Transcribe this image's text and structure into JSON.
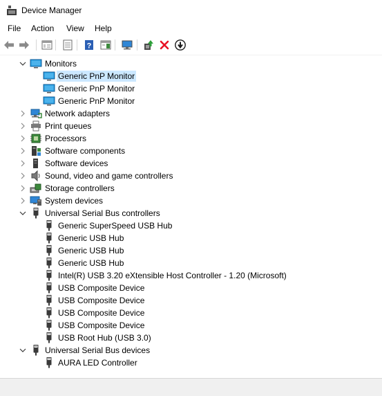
{
  "window": {
    "title": "Device Manager"
  },
  "menu": [
    "File",
    "Action",
    "View",
    "Help"
  ],
  "toolbar": [
    {
      "name": "back-icon"
    },
    {
      "name": "forward-icon"
    },
    {
      "name": "sep"
    },
    {
      "name": "show-hide-console-tree-icon"
    },
    {
      "name": "sep"
    },
    {
      "name": "properties-icon"
    },
    {
      "name": "sep"
    },
    {
      "name": "help-icon"
    },
    {
      "name": "action-pane-icon"
    },
    {
      "name": "sep"
    },
    {
      "name": "scan-hardware-icon"
    },
    {
      "name": "sep"
    },
    {
      "name": "update-driver-icon"
    },
    {
      "name": "uninstall-device-icon"
    },
    {
      "name": "disable-device-icon"
    }
  ],
  "tree": [
    {
      "level": 0,
      "expand": "expanded",
      "icon": "monitor-icon",
      "label": "Monitors"
    },
    {
      "level": 1,
      "icon": "monitor-icon",
      "label": "Generic PnP Monitor",
      "selected": true
    },
    {
      "level": 1,
      "icon": "monitor-icon",
      "label": "Generic PnP Monitor"
    },
    {
      "level": 1,
      "icon": "monitor-icon",
      "label": "Generic PnP Monitor"
    },
    {
      "level": 0,
      "expand": "collapsed",
      "icon": "network-adapter-icon",
      "label": "Network adapters"
    },
    {
      "level": 0,
      "expand": "collapsed",
      "icon": "printer-icon",
      "label": "Print queues"
    },
    {
      "level": 0,
      "expand": "collapsed",
      "icon": "processor-icon",
      "label": "Processors"
    },
    {
      "level": 0,
      "expand": "collapsed",
      "icon": "software-component-icon",
      "label": "Software components"
    },
    {
      "level": 0,
      "expand": "collapsed",
      "icon": "software-device-icon",
      "label": "Software devices"
    },
    {
      "level": 0,
      "expand": "collapsed",
      "icon": "speaker-icon",
      "label": "Sound, video and game controllers"
    },
    {
      "level": 0,
      "expand": "collapsed",
      "icon": "storage-controller-icon",
      "label": "Storage controllers"
    },
    {
      "level": 0,
      "expand": "collapsed",
      "icon": "system-device-icon",
      "label": "System devices"
    },
    {
      "level": 0,
      "expand": "expanded",
      "icon": "usb-icon",
      "label": "Universal Serial Bus controllers"
    },
    {
      "level": 1,
      "icon": "usb-icon",
      "label": "Generic SuperSpeed USB Hub"
    },
    {
      "level": 1,
      "icon": "usb-icon",
      "label": "Generic USB Hub"
    },
    {
      "level": 1,
      "icon": "usb-icon",
      "label": "Generic USB Hub"
    },
    {
      "level": 1,
      "icon": "usb-icon",
      "label": "Generic USB Hub"
    },
    {
      "level": 1,
      "icon": "usb-icon",
      "label": "Intel(R) USB 3.20 eXtensible Host Controller - 1.20 (Microsoft)"
    },
    {
      "level": 1,
      "icon": "usb-icon",
      "label": "USB Composite Device"
    },
    {
      "level": 1,
      "icon": "usb-icon",
      "label": "USB Composite Device"
    },
    {
      "level": 1,
      "icon": "usb-icon",
      "label": "USB Composite Device"
    },
    {
      "level": 1,
      "icon": "usb-icon",
      "label": "USB Composite Device"
    },
    {
      "level": 1,
      "icon": "usb-icon",
      "label": "USB Root Hub (USB 3.0)"
    },
    {
      "level": 0,
      "expand": "expanded",
      "icon": "usb-icon",
      "label": "Universal Serial Bus devices"
    },
    {
      "level": 1,
      "icon": "usb-icon",
      "label": "AURA LED Controller"
    }
  ],
  "colors": {
    "selection": "#cce8ff",
    "monitor": "#1e9be0",
    "uninstall": "#e81123",
    "driver": "#2e9f3a"
  }
}
